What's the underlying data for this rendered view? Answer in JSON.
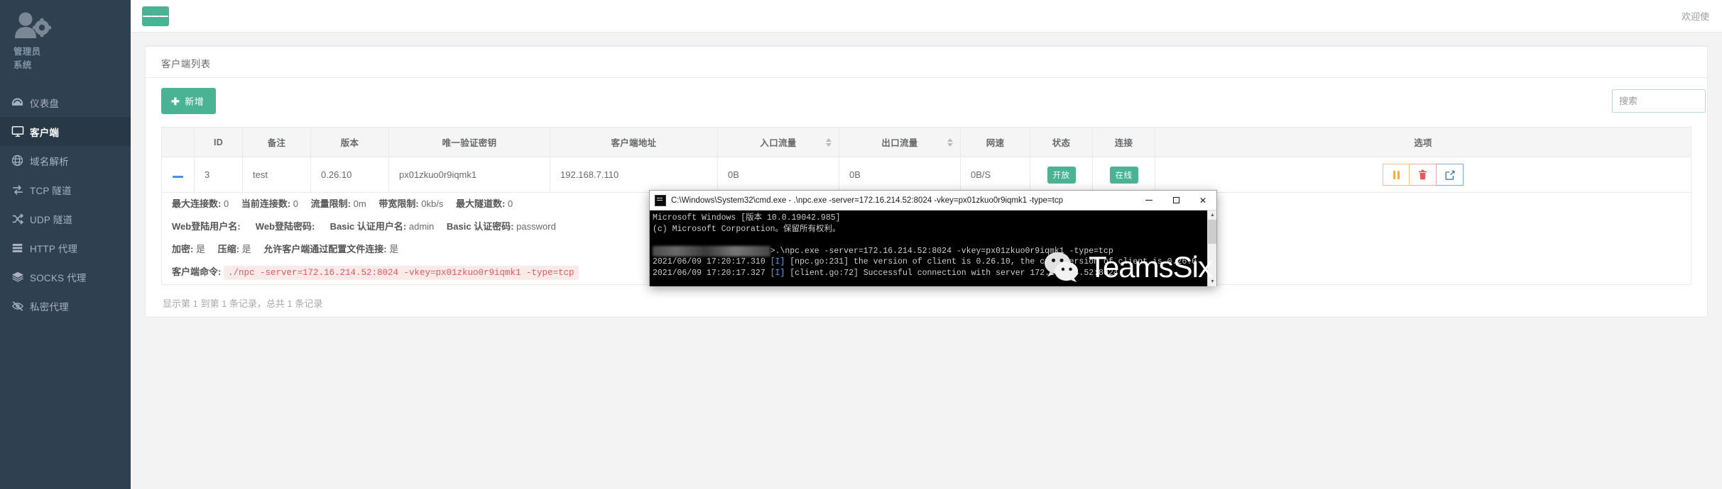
{
  "sidebar": {
    "profile": {
      "role": "管理员",
      "system": "系统"
    },
    "items": [
      {
        "label": "仪表盘",
        "icon": "dashboard-icon",
        "active": false
      },
      {
        "label": "客户端",
        "icon": "monitor-icon",
        "active": true
      },
      {
        "label": "域名解析",
        "icon": "globe-icon",
        "active": false
      },
      {
        "label": "TCP 隧道",
        "icon": "exchange-icon",
        "active": false
      },
      {
        "label": "UDP 隧道",
        "icon": "shuffle-icon",
        "active": false
      },
      {
        "label": "HTTP 代理",
        "icon": "server-icon",
        "active": false
      },
      {
        "label": "SOCKS 代理",
        "icon": "layers-icon",
        "active": false
      },
      {
        "label": "私密代理",
        "icon": "eye-slash-icon",
        "active": false
      }
    ]
  },
  "topbar": {
    "menu_toggle_icon": "hamburger-icon",
    "welcome": "欢迎使"
  },
  "card": {
    "title": "客户端列表",
    "add_button": {
      "label": "新增",
      "icon": "plus-icon"
    },
    "search": {
      "placeholder": "搜索",
      "value": ""
    }
  },
  "table": {
    "columns": [
      {
        "label": "",
        "sortable": false
      },
      {
        "label": "ID",
        "sortable": false
      },
      {
        "label": "备注",
        "sortable": false
      },
      {
        "label": "版本",
        "sortable": false
      },
      {
        "label": "唯一验证密钥",
        "sortable": false
      },
      {
        "label": "客户端地址",
        "sortable": false
      },
      {
        "label": "入口流量",
        "sortable": true
      },
      {
        "label": "出口流量",
        "sortable": true
      },
      {
        "label": "网速",
        "sortable": false
      },
      {
        "label": "状态",
        "sortable": false
      },
      {
        "label": "连接",
        "sortable": false
      },
      {
        "label": "选项",
        "sortable": false
      }
    ],
    "rows": [
      {
        "expand_icon": "minus-icon",
        "id": "3",
        "remark": "test",
        "version": "0.26.10",
        "vkey": "px01zkuo0r9iqmk1",
        "address": "192.168.7.110",
        "in_flow": "0B",
        "out_flow": "0B",
        "speed": "0B/S",
        "status": "开放",
        "connection": "在线",
        "actions": [
          {
            "name": "pause-button",
            "icon": "pause-icon"
          },
          {
            "name": "delete-button",
            "icon": "trash-icon"
          },
          {
            "name": "edit-button",
            "icon": "edit-icon"
          }
        ]
      }
    ],
    "detail": {
      "line1": [
        {
          "label": "最大连接数:",
          "value": "0"
        },
        {
          "label": "当前连接数:",
          "value": "0"
        },
        {
          "label": "流量限制:",
          "value": "0m"
        },
        {
          "label": "带宽限制:",
          "value": "0kb/s"
        },
        {
          "label": "最大隧道数:",
          "value": "0"
        }
      ],
      "line2": [
        {
          "label": "Web登陆用户名:",
          "value": ""
        },
        {
          "label": "Web登陆密码:",
          "value": ""
        },
        {
          "label": "Basic 认证用户名:",
          "value": "admin"
        },
        {
          "label": "Basic 认证密码:",
          "value": "password"
        }
      ],
      "line3": [
        {
          "label": "加密:",
          "value": "是"
        },
        {
          "label": "压缩:",
          "value": "是"
        },
        {
          "label": "允许客户端通过配置文件连接:",
          "value": "是"
        }
      ],
      "line4": {
        "label": "客户端命令:",
        "command": "./npc -server=172.16.214.52:8024 -vkey=px01zkuo0r9iqmk1 -type=tcp"
      }
    },
    "footer_info": "显示第 1 到第 1 条记录，总共 1 条记录"
  },
  "cmd_window": {
    "icon": "cmd-icon",
    "title": "C:\\Windows\\System32\\cmd.exe - .\\npc.exe  -server=172.16.214.52:8024 -vkey=px01zkuo0r9iqmk1 -type=tcp",
    "buttons": {
      "minimize": "−",
      "maximize": "▢",
      "close": "✕"
    },
    "lines": [
      {
        "text": "Microsoft Windows [版本 10.0.19042.985]"
      },
      {
        "text": "(c) Microsoft Corporation。保留所有权利。"
      },
      {
        "text": ""
      },
      {
        "blurred_prefix": "C:\\Users\\xxxxxxx\\Desktop",
        "text": ">.\\npc.exe -server=172.16.214.52:8024 -vkey=px01zkuo0r9iqmk1 -type=tcp"
      },
      {
        "timestamp": "2021/06/09 17:20:17.310",
        "level": "[I]",
        "text": "[npc.go:231]   the version of client is 0.26.10, the core version of client is 0.26.0"
      },
      {
        "timestamp": "2021/06/09 17:20:17.327",
        "level": "[I]",
        "text": "[client.go:72]  Successful connection with server 172.16.214.52:8024"
      }
    ]
  },
  "watermark": {
    "text": "TeamsSix",
    "icon": "wechat-icon"
  },
  "colors": {
    "sidebar_bg": "#2f4050",
    "sidebar_active_bg": "#293846",
    "accent_green": "#4ab394",
    "danger": "#ed5565",
    "warning": "#f0ad4e",
    "info": "#1c84c6",
    "code_red": "#e35b5b"
  }
}
